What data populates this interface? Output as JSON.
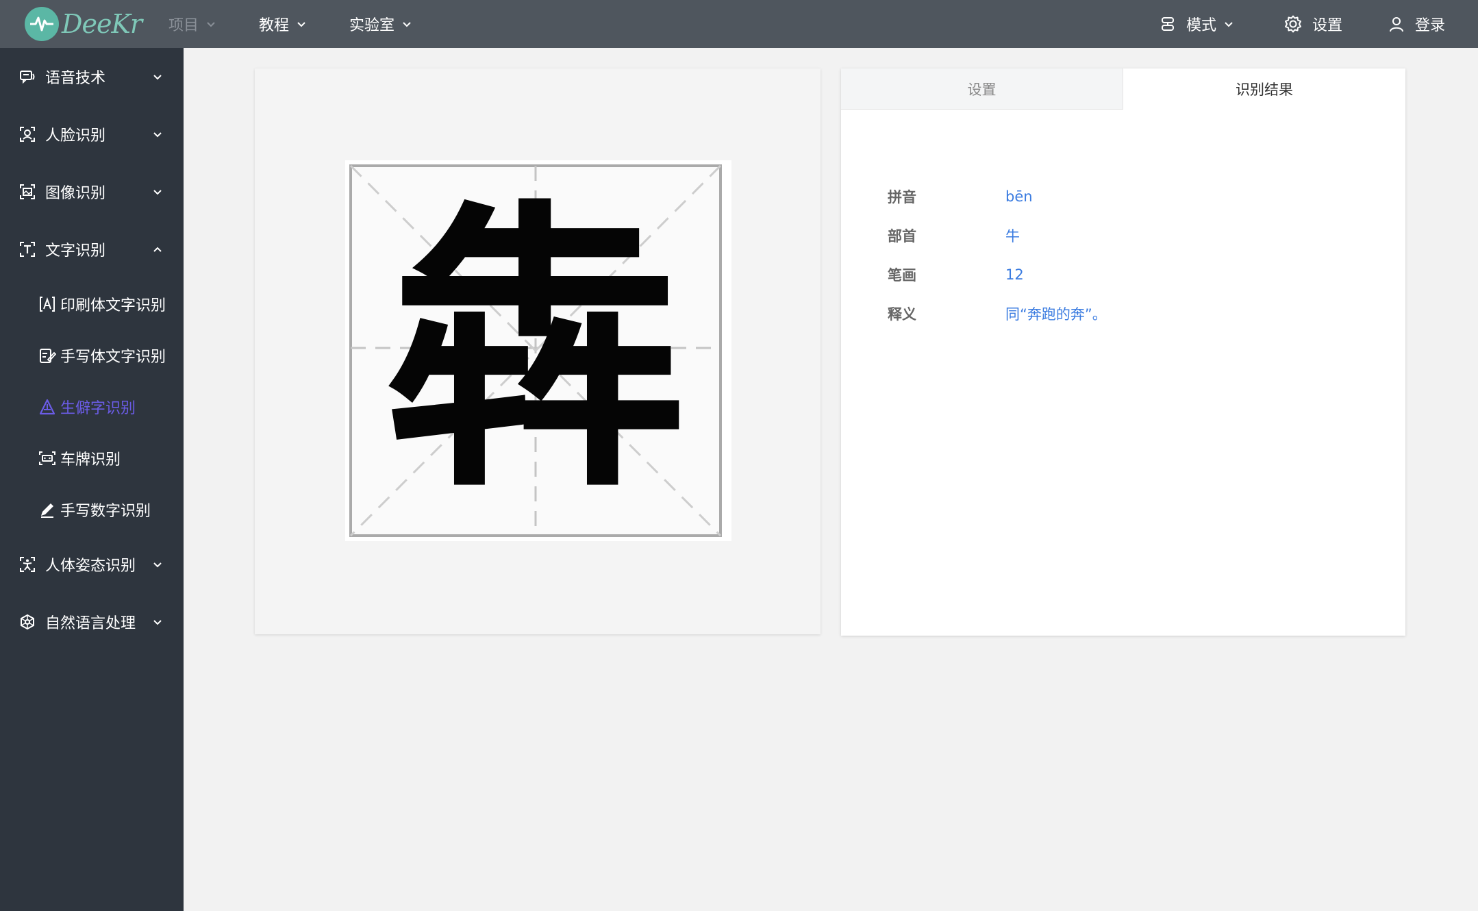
{
  "header": {
    "logo_text": "DeeKr",
    "nav": [
      {
        "label": "项目",
        "disabled": true
      },
      {
        "label": "教程",
        "disabled": false
      },
      {
        "label": "实验室",
        "disabled": false
      }
    ],
    "mode_label": "模式",
    "settings_label": "设置",
    "login_label": "登录"
  },
  "sidebar": {
    "groups": [
      {
        "label": "语音技术",
        "icon": "speech-icon",
        "expanded": false
      },
      {
        "label": "人脸识别",
        "icon": "face-icon",
        "expanded": false
      },
      {
        "label": "图像识别",
        "icon": "image-icon",
        "expanded": false
      },
      {
        "label": "文字识别",
        "icon": "text-icon",
        "expanded": true
      },
      {
        "label": "人体姿态识别",
        "icon": "pose-icon",
        "expanded": false
      },
      {
        "label": "自然语言处理",
        "icon": "nlp-icon",
        "expanded": false
      }
    ],
    "sub_items": [
      {
        "label": "印刷体文字识别",
        "icon": "print-text-icon",
        "active": false
      },
      {
        "label": "手写体文字识别",
        "icon": "handwriting-icon",
        "active": false
      },
      {
        "label": "生僻字识别",
        "icon": "rare-char-icon",
        "active": true
      },
      {
        "label": "车牌识别",
        "icon": "license-plate-icon",
        "active": false
      },
      {
        "label": "手写数字识别",
        "icon": "pen-icon",
        "active": false
      }
    ]
  },
  "image": {
    "character": "犇"
  },
  "result_panel": {
    "tabs": [
      {
        "label": "设置",
        "active": false
      },
      {
        "label": "识别结果",
        "active": true
      }
    ],
    "rows": [
      {
        "label": "拼音",
        "value": "bēn"
      },
      {
        "label": "部首",
        "value": "牛"
      },
      {
        "label": "笔画",
        "value": "12"
      },
      {
        "label": "释义",
        "value": "同“奔跑的奔”。"
      }
    ]
  },
  "colors": {
    "topbar": "#4f565e",
    "sidebar": "#2e353e",
    "accent": "#6b5ce7",
    "value_blue": "#3a7be0"
  }
}
